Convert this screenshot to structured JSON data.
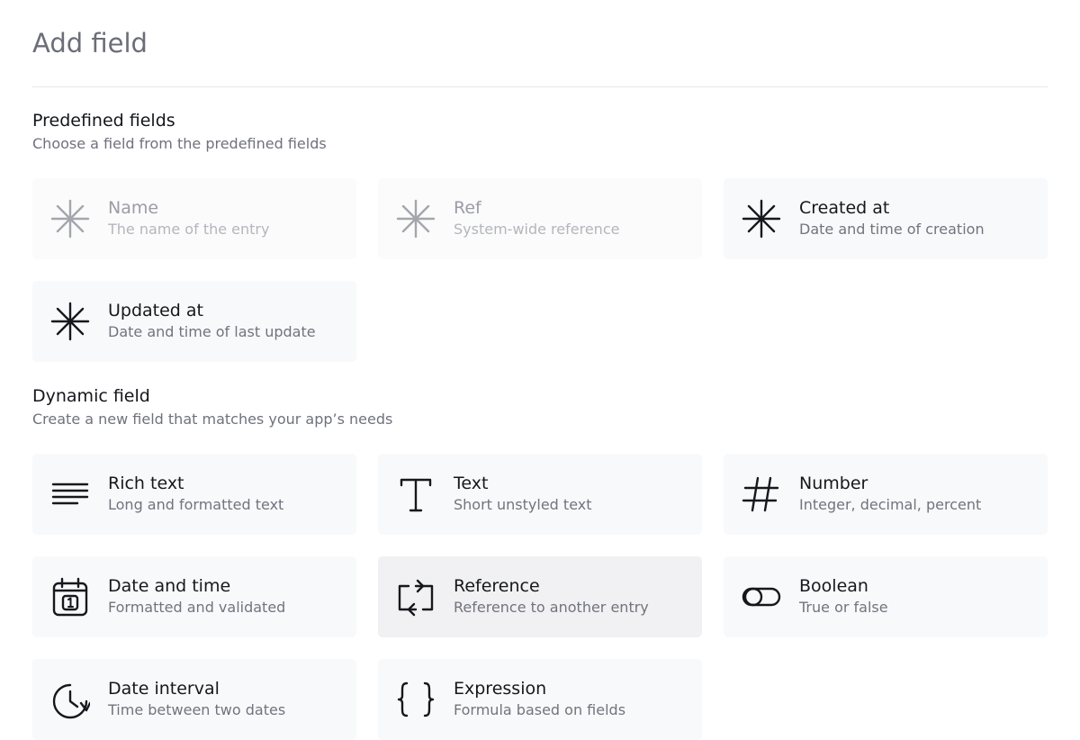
{
  "title": "Add field",
  "predefined": {
    "heading": "Predefined fields",
    "subheading": "Choose a field from the predefined fields",
    "items": [
      {
        "label": "Name",
        "description": "The name of the entry",
        "icon": "asterisk-icon",
        "disabled": true
      },
      {
        "label": "Ref",
        "description": "System-wide reference",
        "icon": "asterisk-icon",
        "disabled": true
      },
      {
        "label": "Created at",
        "description": "Date and time of creation",
        "icon": "asterisk-icon",
        "disabled": false
      },
      {
        "label": "Updated at",
        "description": "Date and time of last update",
        "icon": "asterisk-icon",
        "disabled": false
      }
    ]
  },
  "dynamic": {
    "heading": "Dynamic field",
    "subheading": "Create a new field that matches your app’s needs",
    "items": [
      {
        "label": "Rich text",
        "description": "Long and formatted text",
        "icon": "paragraph-lines-icon"
      },
      {
        "label": "Text",
        "description": "Short unstyled text",
        "icon": "text-t-icon"
      },
      {
        "label": "Number",
        "description": "Integer, decimal, percent",
        "icon": "hash-icon"
      },
      {
        "label": "Date and time",
        "description": "Formatted and validated",
        "icon": "calendar-icon"
      },
      {
        "label": "Reference",
        "description": "Reference to another entry",
        "icon": "swap-arrows-icon",
        "highlighted": true
      },
      {
        "label": "Boolean",
        "description": "True or false",
        "icon": "toggle-icon"
      },
      {
        "label": "Date interval",
        "description": "Time between two dates",
        "icon": "clock-arrow-icon"
      },
      {
        "label": "Expression",
        "description": "Formula based on fields",
        "icon": "curly-braces-icon"
      }
    ]
  },
  "colors": {
    "card_background": "#f8f9fb",
    "card_hover": "#f1f1f3",
    "text_primary": "#16181d",
    "text_secondary": "#71747e",
    "text_disabled": "#b4b6bc"
  }
}
